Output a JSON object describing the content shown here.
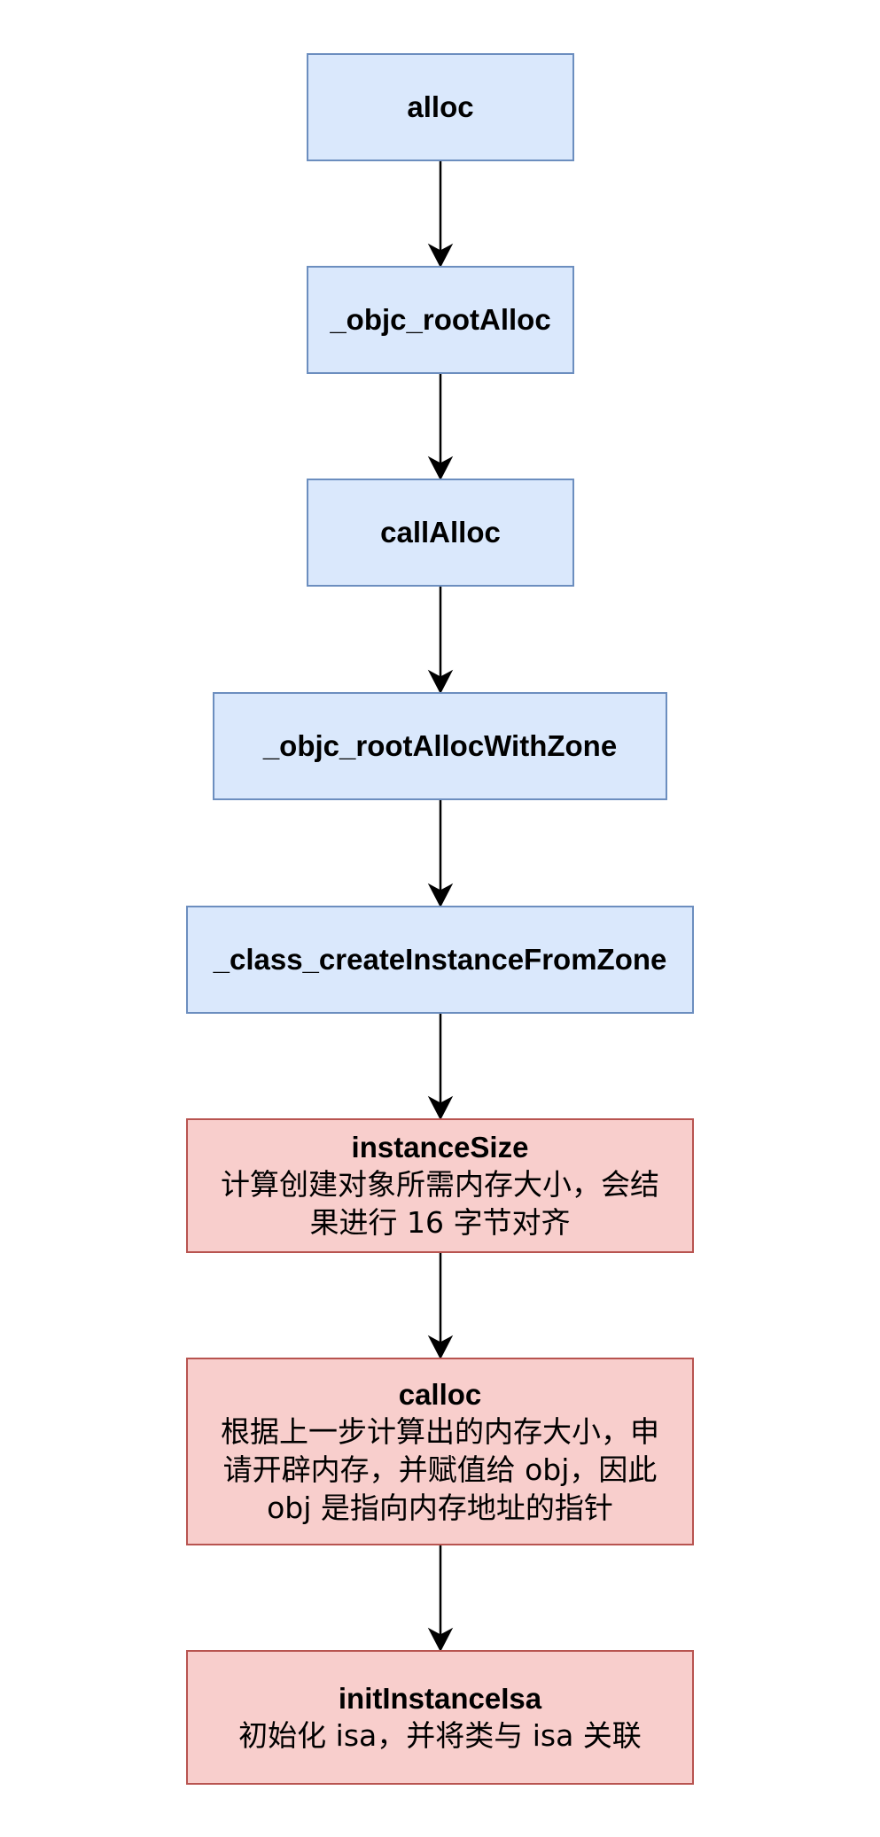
{
  "nodes": [
    {
      "id": "alloc",
      "title": "alloc",
      "description": ""
    },
    {
      "id": "objc-rootalloc",
      "title": "_objc_rootAlloc",
      "description": ""
    },
    {
      "id": "callalloc",
      "title": "callAlloc",
      "description": ""
    },
    {
      "id": "objc-rootallocwithzone",
      "title": "_objc_rootAllocWithZone",
      "description": ""
    },
    {
      "id": "class-createinstancefromzone",
      "title": "_class_createInstanceFromZone",
      "description": ""
    },
    {
      "id": "instancesize",
      "title": "instanceSize",
      "description": [
        "计算创建对象所需内存大小，会结",
        "果进行 16 字节对齐"
      ]
    },
    {
      "id": "calloc",
      "title": "calloc",
      "description": [
        "根据上一步计算出的内存大小，申",
        "请开辟内存，并赋值给 obj，因此",
        "obj 是指向内存地址的指针"
      ]
    },
    {
      "id": "initinstanceisa",
      "title": "initInstanceIsa",
      "description": [
        "初始化 isa，并将类与 isa 关联"
      ]
    }
  ],
  "colors": {
    "blue_fill": "#dae8fc",
    "blue_stroke": "#6c8ebf",
    "red_fill": "#f8cecc",
    "red_stroke": "#b85450",
    "arrow": "#000000"
  }
}
